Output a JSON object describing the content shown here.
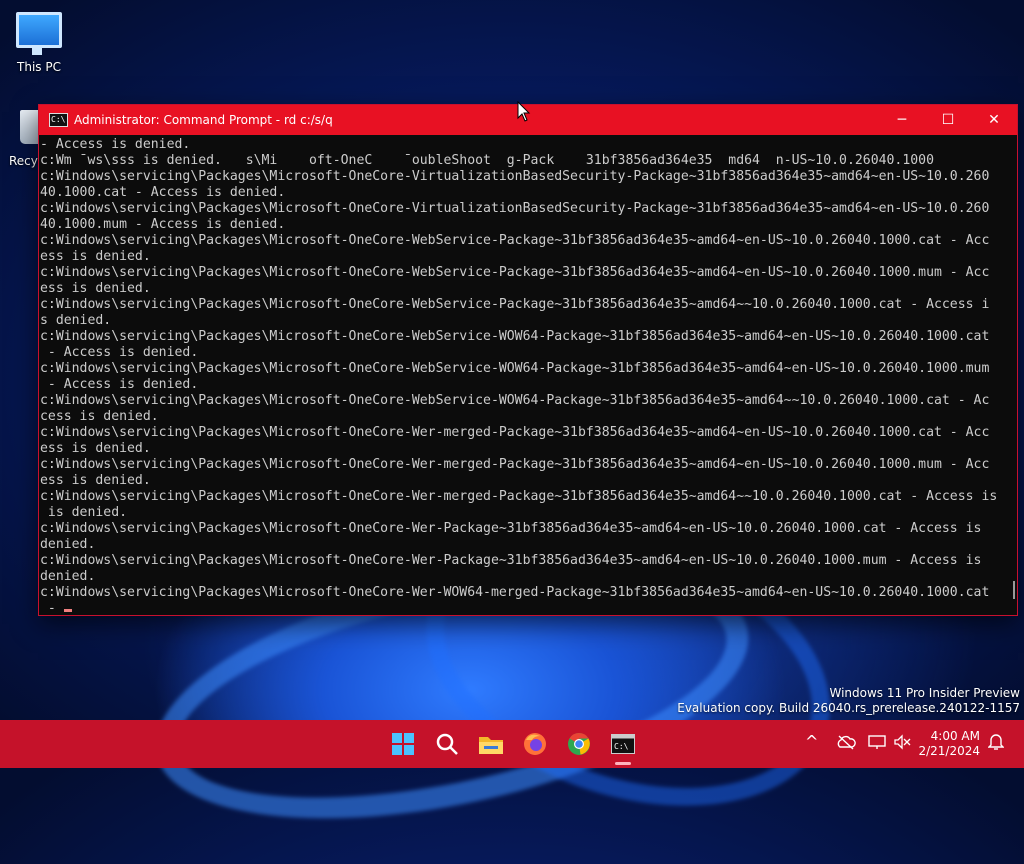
{
  "desktop": {
    "icons": [
      {
        "label": "This PC"
      },
      {
        "label": "Recyc"
      }
    ]
  },
  "window": {
    "title": "Administrator: Command Prompt - rd  c:/s/q",
    "controls": {
      "minimize": "─",
      "maximize": "☐",
      "close": "✕"
    },
    "console_lines": [
      "- Access is denied.",
      "c:Wm ̄ ws\\sss is denied.   s\\Mi    oft-OneC    ̄ oubleShoot  g-Pack    31bf3856ad364e35  md64  n-US~10.0.26040.1000",
      "c:Windows\\servicing\\Packages\\Microsoft-OneCore-VirtualizationBasedSecurity-Package~31bf3856ad364e35~amd64~en-US~10.0.260",
      "40.1000.cat - Access is denied.",
      "c:Windows\\servicing\\Packages\\Microsoft-OneCore-VirtualizationBasedSecurity-Package~31bf3856ad364e35~amd64~en-US~10.0.260",
      "40.1000.mum - Access is denied.",
      "c:Windows\\servicing\\Packages\\Microsoft-OneCore-WebService-Package~31bf3856ad364e35~amd64~en-US~10.0.26040.1000.cat - Acc",
      "ess is denied.",
      "c:Windows\\servicing\\Packages\\Microsoft-OneCore-WebService-Package~31bf3856ad364e35~amd64~en-US~10.0.26040.1000.mum - Acc",
      "ess is denied.",
      "c:Windows\\servicing\\Packages\\Microsoft-OneCore-WebService-Package~31bf3856ad364e35~amd64~~10.0.26040.1000.cat - Access i",
      "s denied.",
      "c:Windows\\servicing\\Packages\\Microsoft-OneCore-WebService-WOW64-Package~31bf3856ad364e35~amd64~en-US~10.0.26040.1000.cat",
      " - Access is denied.",
      "c:Windows\\servicing\\Packages\\Microsoft-OneCore-WebService-WOW64-Package~31bf3856ad364e35~amd64~en-US~10.0.26040.1000.mum",
      " - Access is denied.",
      "c:Windows\\servicing\\Packages\\Microsoft-OneCore-WebService-WOW64-Package~31bf3856ad364e35~amd64~~10.0.26040.1000.cat - Ac",
      "cess is denied.",
      "c:Windows\\servicing\\Packages\\Microsoft-OneCore-Wer-merged-Package~31bf3856ad364e35~amd64~en-US~10.0.26040.1000.cat - Acc",
      "ess is denied.",
      "c:Windows\\servicing\\Packages\\Microsoft-OneCore-Wer-merged-Package~31bf3856ad364e35~amd64~en-US~10.0.26040.1000.mum - Acc",
      "ess is denied.",
      "c:Windows\\servicing\\Packages\\Microsoft-OneCore-Wer-merged-Package~31bf3856ad364e35~amd64~~10.0.26040.1000.cat - Access is",
      " is denied.",
      "c:Windows\\servicing\\Packages\\Microsoft-OneCore-Wer-Package~31bf3856ad364e35~amd64~en-US~10.0.26040.1000.cat - Access is",
      "denied.",
      "c:Windows\\servicing\\Packages\\Microsoft-OneCore-Wer-Package~31bf3856ad364e35~amd64~en-US~10.0.26040.1000.mum - Access is",
      "denied.",
      "c:Windows\\servicing\\Packages\\Microsoft-OneCore-Wer-WOW64-merged-Package~31bf3856ad364e35~amd64~en-US~10.0.26040.1000.cat",
      " - "
    ]
  },
  "watermark": {
    "line1": "Windows 11 Pro Insider Preview",
    "line2": "Evaluation copy. Build 26040.rs_prerelease.240122-1157"
  },
  "taskbar": {
    "apps": [
      {
        "name": "start",
        "icon": "windows-logo"
      },
      {
        "name": "search",
        "icon": "search-icon"
      },
      {
        "name": "file-explorer",
        "icon": "folder-icon"
      },
      {
        "name": "firefox",
        "icon": "firefox-icon"
      },
      {
        "name": "chrome",
        "icon": "chrome-icon"
      },
      {
        "name": "terminal",
        "icon": "terminal-icon",
        "active": true
      }
    ],
    "tray": {
      "chevron": "^",
      "time": "4:00 AM",
      "date": "2/21/2024"
    }
  },
  "colors": {
    "title_bar": "#e81123",
    "taskbar": "#c5122a",
    "console_bg": "#0c0c0c",
    "console_text": "#cccccc"
  }
}
